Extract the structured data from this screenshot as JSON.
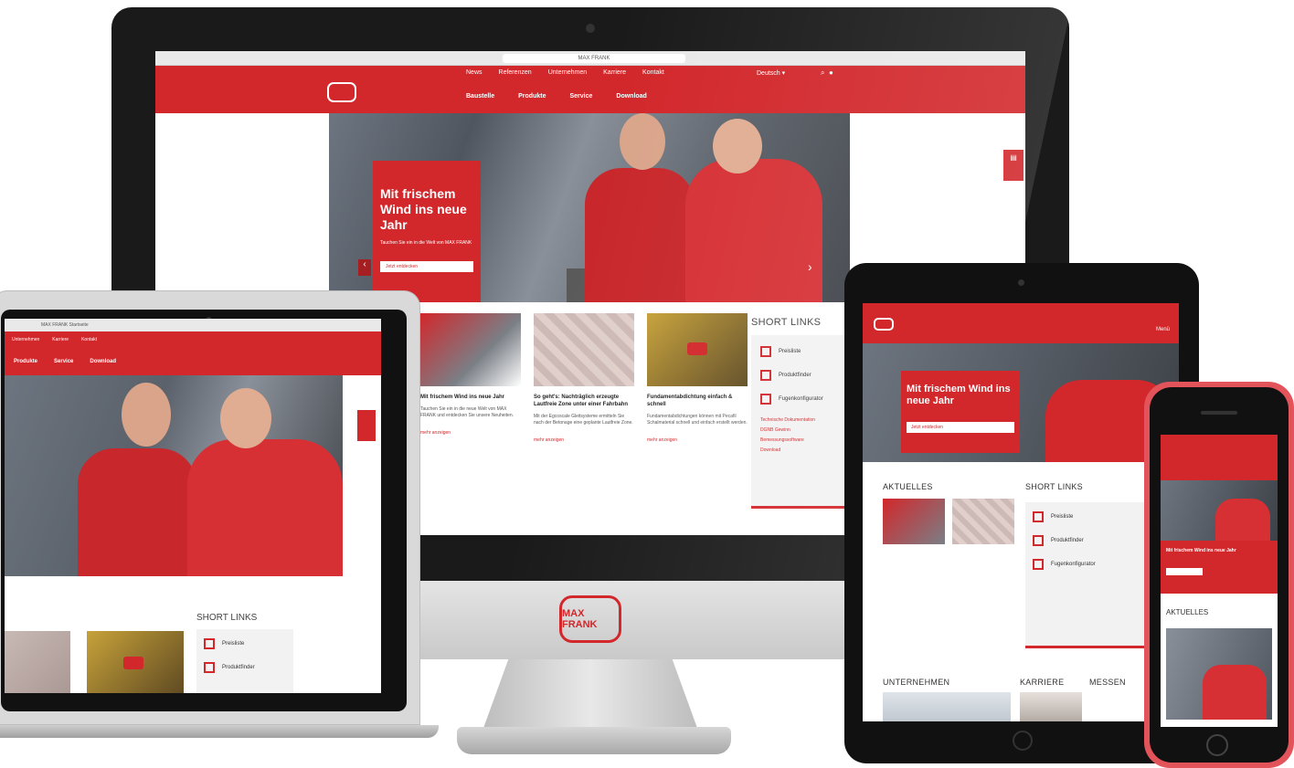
{
  "desktop": {
    "url": "MAX FRANK",
    "top_links": [
      "News",
      "Referenzen",
      "Unternehmen",
      "Karriere",
      "Kontakt"
    ],
    "language": "Deutsch",
    "nav": [
      "Baustelle",
      "Produkte",
      "Service",
      "Download"
    ],
    "hero": {
      "headline": "Mit frischem Wind ins neue Jahr",
      "text": "Tauchen Sie ein in die Welt von MAX FRANK",
      "button": "Jetzt entdecken"
    },
    "news": [
      {
        "title": "Mit frischem Wind ins neue Jahr",
        "text": "Tauchen Sie ein in die neue Welt von MAX FRANK und entdecken Sie unsere Neuheiten.",
        "more": "mehr anzeigen"
      },
      {
        "title": "So geht's: Nachträglich erzeugte Lautfreie Zone unter einer Fahrbahn",
        "text": "Mit der Egcoscale Gleitsysteme ermitteln Sie nach der Betonage eine geplante Lautfreie Zone.",
        "more": "mehr anzeigen"
      },
      {
        "title": "Fundamentabdichtung einfach & schnell",
        "text": "Fundamentabdichtungen können mit Pecafil Schalmaterial schnell und einfach erstellt werden.",
        "more": "mehr anzeigen"
      }
    ],
    "short_links_title": "SHORT LINKS",
    "short_links": [
      "Preisliste",
      "Produktfinder",
      "Fugenkonfigurator"
    ],
    "short_text_links": [
      "Technische Dokumentation",
      "DGNB Gewinn",
      "Bemessungssoftware",
      "Download"
    ]
  },
  "monitor_brand": "MAX FRANK",
  "laptop": {
    "browser_title": "MAX FRANK Startseite",
    "top_links": [
      "Unternehmen",
      "Karriere",
      "Kontakt"
    ],
    "nav": [
      "Produkte",
      "Service",
      "Download"
    ],
    "short_links_title": "SHORT LINKS",
    "short_links": [
      "Preisliste",
      "Produktfinder"
    ]
  },
  "tablet": {
    "menu": "Menü",
    "hero_headline": "Mit frischem Wind ins neue Jahr",
    "hero_button": "Jetzt entdecken",
    "sections": [
      "AKTUELLES",
      "SHORT LINKS",
      "UNTERNEHMEN",
      "KARRIERE",
      "MESSEN"
    ],
    "short_links": [
      "Preisliste",
      "Produktfinder",
      "Fugenkonfigurator"
    ]
  },
  "phone": {
    "hero_text": "Mit frischem Wind ins neue Jahr",
    "section": "AKTUELLES"
  },
  "colors": {
    "brand_red": "#d2272b",
    "dark_frame": "#111111",
    "phone_case": "#e3535a"
  },
  "icons": [
    "search-icon",
    "user-icon",
    "play-icon",
    "chevron-left-icon",
    "chevron-right-icon",
    "document-icon"
  ]
}
